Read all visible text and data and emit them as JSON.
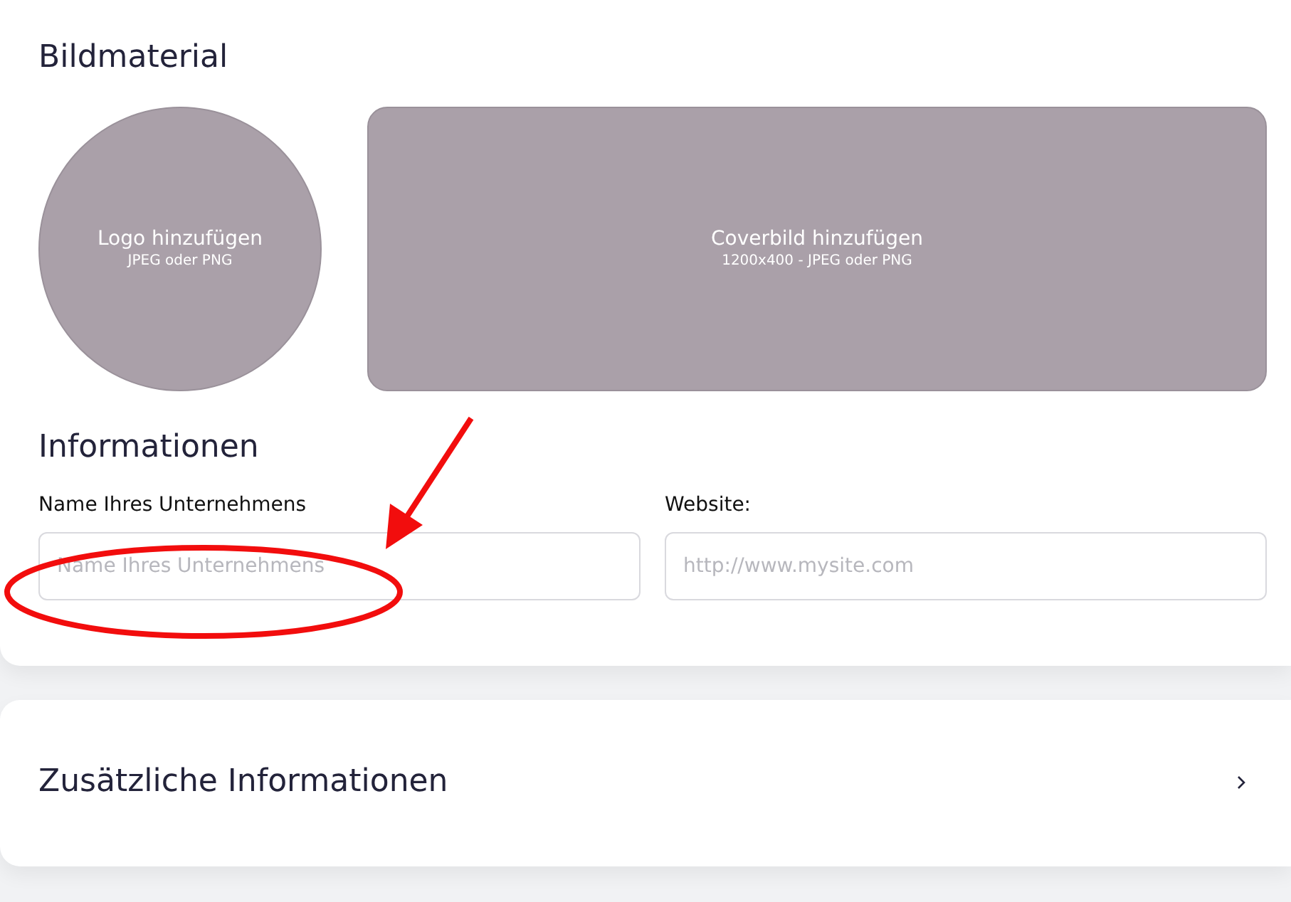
{
  "media": {
    "title": "Bildmaterial",
    "logo": {
      "label": "Logo hinzufügen",
      "hint": "JPEG oder PNG"
    },
    "cover": {
      "label": "Coverbild hinzufügen",
      "hint": "1200x400 - JPEG oder PNG"
    }
  },
  "info": {
    "title": "Informationen",
    "fields": [
      {
        "label": "Name Ihres Unternehmens",
        "placeholder": "Name Ihres Unternehmens"
      },
      {
        "label": "Website:",
        "placeholder": "http://www.mysite.com"
      }
    ]
  },
  "extra": {
    "title": "Zusätzliche Informationen",
    "expanded": false
  },
  "annotations": {
    "arrow": true,
    "ellipse": true
  }
}
